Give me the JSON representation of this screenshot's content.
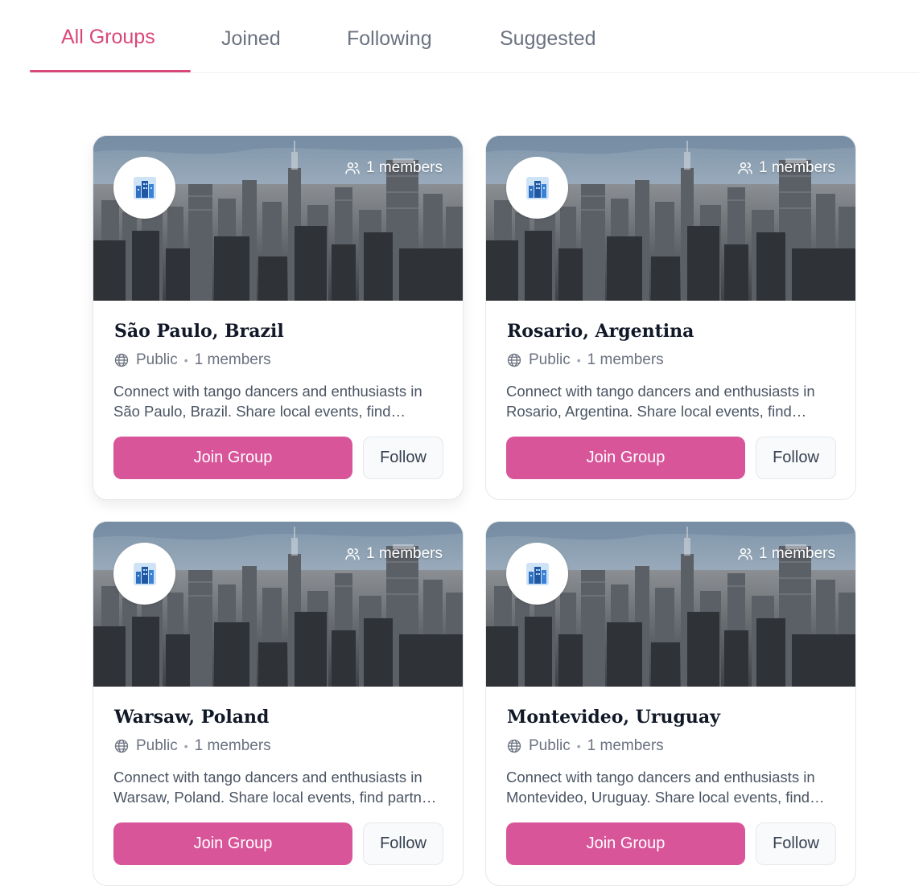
{
  "tabs": [
    {
      "label": "All Groups",
      "active": true
    },
    {
      "label": "Joined",
      "active": false
    },
    {
      "label": "Following",
      "active": false
    },
    {
      "label": "Suggested",
      "active": false
    }
  ],
  "colors": {
    "accent": "#d9477a",
    "join_button": "#d9559a",
    "tab_inactive": "#6b7280"
  },
  "groups": [
    {
      "title": "São Paulo, Brazil",
      "members_badge": "1 members",
      "privacy": "Public",
      "members_meta": "1 members",
      "description": "Connect with tango dancers and enthusiasts in São Paulo, Brazil. Share local events, find partners and more.",
      "join_label": "Join Group",
      "follow_label": "Follow",
      "avatar_icon": "city-buildings-icon"
    },
    {
      "title": "Rosario, Argentina",
      "members_badge": "1 members",
      "privacy": "Public",
      "members_meta": "1 members",
      "description": "Connect with tango dancers and enthusiasts in Rosario, Argentina. Share local events, find partners and more.",
      "join_label": "Join Group",
      "follow_label": "Follow",
      "avatar_icon": "city-buildings-icon"
    },
    {
      "title": "Warsaw, Poland",
      "members_badge": "1 members",
      "privacy": "Public",
      "members_meta": "1 members",
      "description": "Connect with tango dancers and enthusiasts in Warsaw, Poland. Share local events, find partners and more.",
      "join_label": "Join Group",
      "follow_label": "Follow",
      "avatar_icon": "city-buildings-icon"
    },
    {
      "title": "Montevideo, Uruguay",
      "members_badge": "1 members",
      "privacy": "Public",
      "members_meta": "1 members",
      "description": "Connect with tango dancers and enthusiasts in Montevideo, Uruguay. Share local events, find partners and more.",
      "join_label": "Join Group",
      "follow_label": "Follow",
      "avatar_icon": "city-buildings-icon"
    }
  ]
}
